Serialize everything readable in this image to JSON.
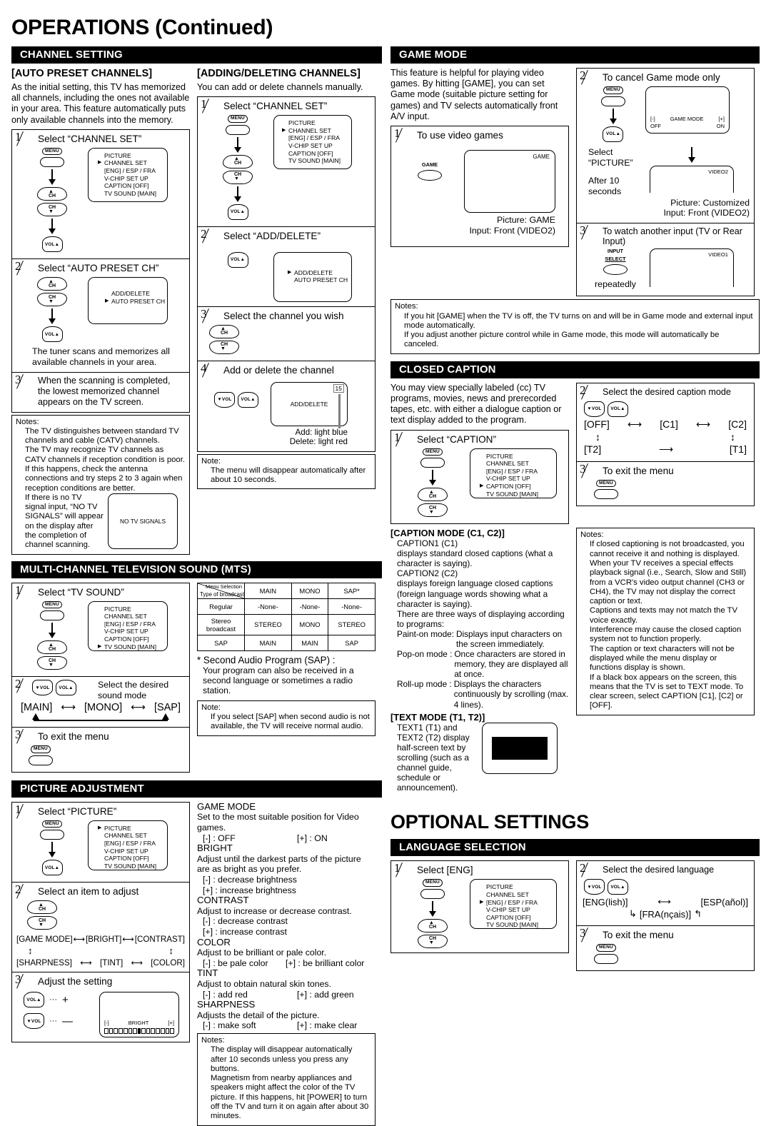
{
  "page": {
    "title": "OPERATIONS (Continued)",
    "title2": "OPTIONAL SETTINGS"
  },
  "menu_list": {
    "picture": "PICTURE",
    "channel_set": "CHANNEL SET",
    "lang": "[ENG] / ESP / FRA",
    "vchip": "V-CHIP SET UP",
    "caption": "CAPTION [OFF]",
    "tvsound": "TV SOUND [MAIN]"
  },
  "keys": {
    "menu": "MENU",
    "ch_up": "CH",
    "ch_dn": "CH",
    "vol_up": "VOL",
    "vol_dn": "VOL",
    "game": "GAME",
    "input_select_1": "INPUT",
    "input_select_2": "SELECT"
  },
  "channel_setting": {
    "bar": "CHANNEL SETTING",
    "auto_preset": {
      "heading": "[AUTO PRESET CHANNELS]",
      "intro": "As the initial setting, this TV has memorized all channels, including the ones not available in your area. This feature automatically puts only available channels into the memory.",
      "step1_num": "1",
      "step1_title": "Select “CHANNEL SET”",
      "step2_num": "2",
      "step2_title": "Select “AUTO PRESET CH”",
      "step2_osd_1": "ADD/DELETE",
      "step2_osd_2": "AUTO PRESET CH",
      "step2_after": "The tuner scans and memorizes all available channels in your area.",
      "step3_num": "3",
      "step3_title": "When the scanning is completed, the lowest memorized channel appears on the TV screen.",
      "notes_head": "Notes:",
      "note1": "The TV distinguishes between standard TV channels and cable (CATV) channels.",
      "note2": "The TV may recognize TV channels as CATV channels if reception condition is poor. If this happens, check the antenna connections and try steps 2 to 3 again when reception conditions are better.",
      "note3": "If there is no TV signal input, “NO TV SIGNALS” will appear on the display after the completion of channel scanning.",
      "no_signal_osd": "NO TV SIGNALS"
    },
    "adding_deleting": {
      "heading": "[ADDING/DELETING CHANNELS]",
      "intro": "You can add or delete channels manually.",
      "step1_num": "1",
      "step1_title": "Select “CHANNEL SET”",
      "step2_num": "2",
      "step2_title": "Select “ADD/DELETE”",
      "step2_osd_1": "ADD/DELETE",
      "step2_osd_2": "AUTO PRESET CH",
      "step3_num": "3",
      "step3_title": "Select the channel you wish",
      "step4_num": "4",
      "step4_title": "Add or delete the channel",
      "step4_osd": "ADD/DELETE",
      "step4_channel": "15",
      "step4_add": "Add: light blue",
      "step4_delete": "Delete: light red",
      "note_head": "Note:",
      "note1": "The menu will disappear automatically after about 10 seconds."
    }
  },
  "mts": {
    "bar": "MULTI-CHANNEL TELEVISION SOUND (MTS)",
    "step1_num": "1",
    "step1_title": "Select “TV SOUND”",
    "step2_num": "2",
    "step2_title": "Select the desired sound mode",
    "cycle": [
      "[MAIN]",
      "[MONO]",
      "[SAP]"
    ],
    "step3_num": "3",
    "step3_title": "To exit the menu",
    "table": {
      "corner_top": "Menu Selection",
      "corner_bottom": "Type of broadcast",
      "headers": [
        "MAIN",
        "MONO",
        "SAP*"
      ],
      "rows": [
        {
          "label": "Regular",
          "cells": [
            "-None-",
            "-None-",
            "-None-"
          ]
        },
        {
          "label": "Stereo broadcast",
          "cells": [
            "STEREO",
            "MONO",
            "STEREO"
          ]
        },
        {
          "label": "SAP",
          "cells": [
            "MAIN",
            "MAIN",
            "SAP"
          ]
        }
      ]
    },
    "sap_head": "* Second Audio Program (SAP) :",
    "sap_text": "Your program can also be received in a second language or sometimes a radio station.",
    "note_head": "Note:",
    "note1": "If you select [SAP] when second audio is not available, the TV will receive normal audio."
  },
  "picture_adjustment": {
    "bar": "PICTURE ADJUSTMENT",
    "step1_num": "1",
    "step1_title": "Select “PICTURE”",
    "step2_num": "2",
    "step2_title": "Select an item to adjust",
    "cycle_top": [
      "[GAME MODE]",
      "[BRIGHT]",
      "[CONTRAST]"
    ],
    "cycle_bottom": [
      "[SHARPNESS]",
      "[TINT]",
      "[COLOR]"
    ],
    "step3_num": "3",
    "step3_title": "Adjust the setting",
    "plus": "+",
    "minus": "—",
    "dots": "···",
    "osd_minus": "[-]",
    "osd_plus": "[+]",
    "osd_label": "BRIGHT",
    "items": [
      {
        "name": "GAME MODE",
        "desc": "Set to the most suitable position for Video games.",
        "minus": "[-] : OFF",
        "plus": "[+] : ON",
        "inline": true
      },
      {
        "name": "BRIGHT",
        "desc": "Adjust until the darkest parts of the picture are as bright as you prefer.",
        "minus": "[-] : decrease brightness",
        "plus": "[+] : increase brightness",
        "inline": false
      },
      {
        "name": "CONTRAST",
        "desc": "Adjust to increase or decrease contrast.",
        "minus": "[-] : decrease contrast",
        "plus": "[+] : increase contrast",
        "inline": false
      },
      {
        "name": "COLOR",
        "desc": "Adjust to be brilliant or pale color.",
        "minus": "[-] : be pale color",
        "plus": "[+] : be brilliant color",
        "inline": true
      },
      {
        "name": "TINT",
        "desc": "Adjust to obtain natural skin tones.",
        "minus": "[-] : add red",
        "plus": "[+] : add green",
        "inline": true
      },
      {
        "name": "SHARPNESS",
        "desc": "Adjusts the detail of the picture.",
        "minus": "[-] : make soft",
        "plus": "[+] : make clear",
        "inline": true
      }
    ],
    "notes_head": "Notes:",
    "note1": "The display will disappear automatically after 10 seconds unless you press any buttons.",
    "note2": "Magnetism from nearby appliances and speakers might affect the color of the TV picture. If this happens, hit [POWER] to turn off the TV and turn it on again after about 30 minutes."
  },
  "game_mode": {
    "bar": "GAME MODE",
    "intro": "This feature is helpful for playing video games. By hitting [GAME], you can set Game mode (suitable picture setting for games) and TV selects automatically front A/V input.",
    "step1_num": "1",
    "step1_title": "To use video games",
    "step1_osd": "GAME",
    "step1_line1": "Picture: GAME",
    "step1_line2": "Input: Front (VIDEO2)",
    "step2_num": "2",
    "step2_title": "To cancel Game mode only",
    "step2_osd_minus": "[-]",
    "step2_osd_label": "GAME MODE",
    "step2_osd_plus": "[+]",
    "step2_osd_off": "OFF",
    "step2_osd_on": "ON",
    "step2_select": "Select “PICTURE”",
    "step2_after": "After 10 seconds",
    "step2_osd2": "VIDEO2",
    "step2_line1": "Picture: Customized",
    "step2_line2": "Input: Front (VIDEO2)",
    "step3_num": "3",
    "step3_title": "To watch another input (TV or Rear Input)",
    "step3_repeatedly": "repeatedly",
    "step3_osd": "VIDEO1",
    "notes_head": "Notes:",
    "note1": "If you hit [GAME] when the TV is off, the TV turns on and will be in Game mode and external input mode automatically.",
    "note2": "If you adjust another picture control while in Game mode, this mode will automatically be canceled."
  },
  "closed_caption": {
    "bar": "CLOSED CAPTION",
    "intro": "You may view specially labeled (cc) TV programs, movies, news and prerecorded tapes, etc. with either a dialogue caption or text display added to the program.",
    "step1_num": "1",
    "step1_title": "Select “CAPTION”",
    "step2_num": "2",
    "step2_title": "Select the desired caption mode",
    "modes": [
      "[OFF]",
      "[C1]",
      "[C2]",
      "[T2]",
      "[T1]"
    ],
    "step3_num": "3",
    "step3_title": "To exit the menu",
    "caption_mode_head": "[CAPTION MODE (C1, C2)]",
    "cm_l1": "CAPTION1 (C1)",
    "cm_l2": "displays standard closed captions (what a character is saying).",
    "cm_l3": "CAPTION2 (C2)",
    "cm_l4": "displays foreign language closed captions (foreign language words showing what a character is saying).",
    "cm_l5": "There are three ways of displaying according to programs:",
    "modes_list": [
      {
        "name": "Paint-on mode:",
        "desc": "Displays input characters on the screen immediately."
      },
      {
        "name": "Pop-on mode  :",
        "desc": "Once characters are stored in memory, they are displayed all at once."
      },
      {
        "name": "Roll-up mode :",
        "desc": "Displays the characters continuously by scrolling (max. 4 lines)."
      }
    ],
    "text_mode_head": "[TEXT MODE (T1, T2)]",
    "tm_text": "TEXT1 (T1) and TEXT2 (T2) display half-screen text by scrolling (such as a channel guide, schedule or announcement).",
    "notes_head": "Notes:",
    "note1": "If closed captioning is not broadcasted, you cannot receive it and nothing is displayed.",
    "note2": "When your TV receives a special effects playback signal (i.e., Search, Slow and Still) from a VCR's video output channel (CH3 or CH4), the TV may not display the correct caption or text.",
    "note3": "Captions and texts may not match the TV voice exactly.",
    "note4": "Interference may cause the closed caption system not to function properly.",
    "note5": "The caption or text characters will not be displayed while the menu display or functions display is shown.",
    "note6": "If a black box appears on the screen, this means that the TV is set to TEXT mode. To clear screen, select CAPTION [C1], [C2] or [OFF]."
  },
  "language_selection": {
    "bar": "LANGUAGE SELECTION",
    "step1_num": "1",
    "step1_title": "Select [ENG]",
    "step2_num": "2",
    "step2_title": "Select the desired language",
    "langs": [
      "[ENG(lish)]",
      "[ESP(añol)]",
      "[FRA(nçais)]"
    ],
    "step3_num": "3",
    "step3_title": "To exit the menu"
  }
}
